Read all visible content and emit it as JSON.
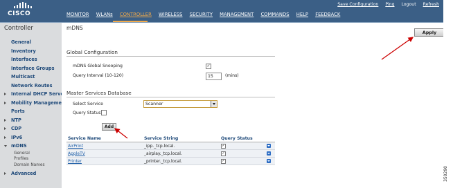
{
  "header": {
    "logo_text": "CISCO",
    "top_links": [
      "Save Configuration",
      "Ping",
      "Logout",
      "Refresh"
    ],
    "nav": [
      "MONITOR",
      "WLANs",
      "CONTROLLER",
      "WIRELESS",
      "SECURITY",
      "MANAGEMENT",
      "COMMANDS",
      "HELP",
      "FEEDBACK"
    ],
    "active_nav": "CONTROLLER",
    "colors": {
      "bar": "#3b5f86",
      "active": "#f0a94b"
    }
  },
  "sidebar": {
    "title": "Controller",
    "items": [
      {
        "label": "General",
        "arrow": ""
      },
      {
        "label": "Inventory",
        "arrow": ""
      },
      {
        "label": "Interfaces",
        "arrow": ""
      },
      {
        "label": "Interface Groups",
        "arrow": ""
      },
      {
        "label": "Multicast",
        "arrow": ""
      },
      {
        "label": "Network Routes",
        "arrow": ""
      },
      {
        "label": "Internal DHCP Server",
        "arrow": "right"
      },
      {
        "label": "Mobility Management",
        "arrow": "right"
      },
      {
        "label": "Ports",
        "arrow": ""
      },
      {
        "label": "NTP",
        "arrow": "right"
      },
      {
        "label": "CDP",
        "arrow": "right"
      },
      {
        "label": "IPv6",
        "arrow": "right"
      },
      {
        "label": "mDNS",
        "arrow": "down"
      }
    ],
    "mdns_sub": [
      "General",
      "Profiles",
      "Domain Names"
    ],
    "advanced": {
      "label": "Advanced",
      "arrow": "right"
    }
  },
  "main": {
    "title": "mDNS",
    "apply_label": "Apply",
    "global_config": {
      "title": "Global Configuration",
      "snooping_label": "mDNS Global Snooping",
      "snooping_checked": true,
      "query_label": "Query Interval (10-120)",
      "query_value": "15",
      "query_unit": "(mins)"
    },
    "msd": {
      "title": "Master Services Database",
      "select_label": "Select Service",
      "select_value": "Scanner",
      "query_status_label": "Query Status",
      "add_label": "Add"
    },
    "table": {
      "headers": [
        "Service Name",
        "Service String",
        "Query Status"
      ],
      "rows": [
        {
          "name": "AirPrint",
          "string": "_ipp._tcp.local.",
          "checked": true
        },
        {
          "name": "AppleTV",
          "string": "_airplay._tcp.local.",
          "checked": true
        },
        {
          "name": "Printer",
          "string": "_printer._tcp.local.",
          "checked": true
        }
      ]
    }
  },
  "figure_id": "350290"
}
